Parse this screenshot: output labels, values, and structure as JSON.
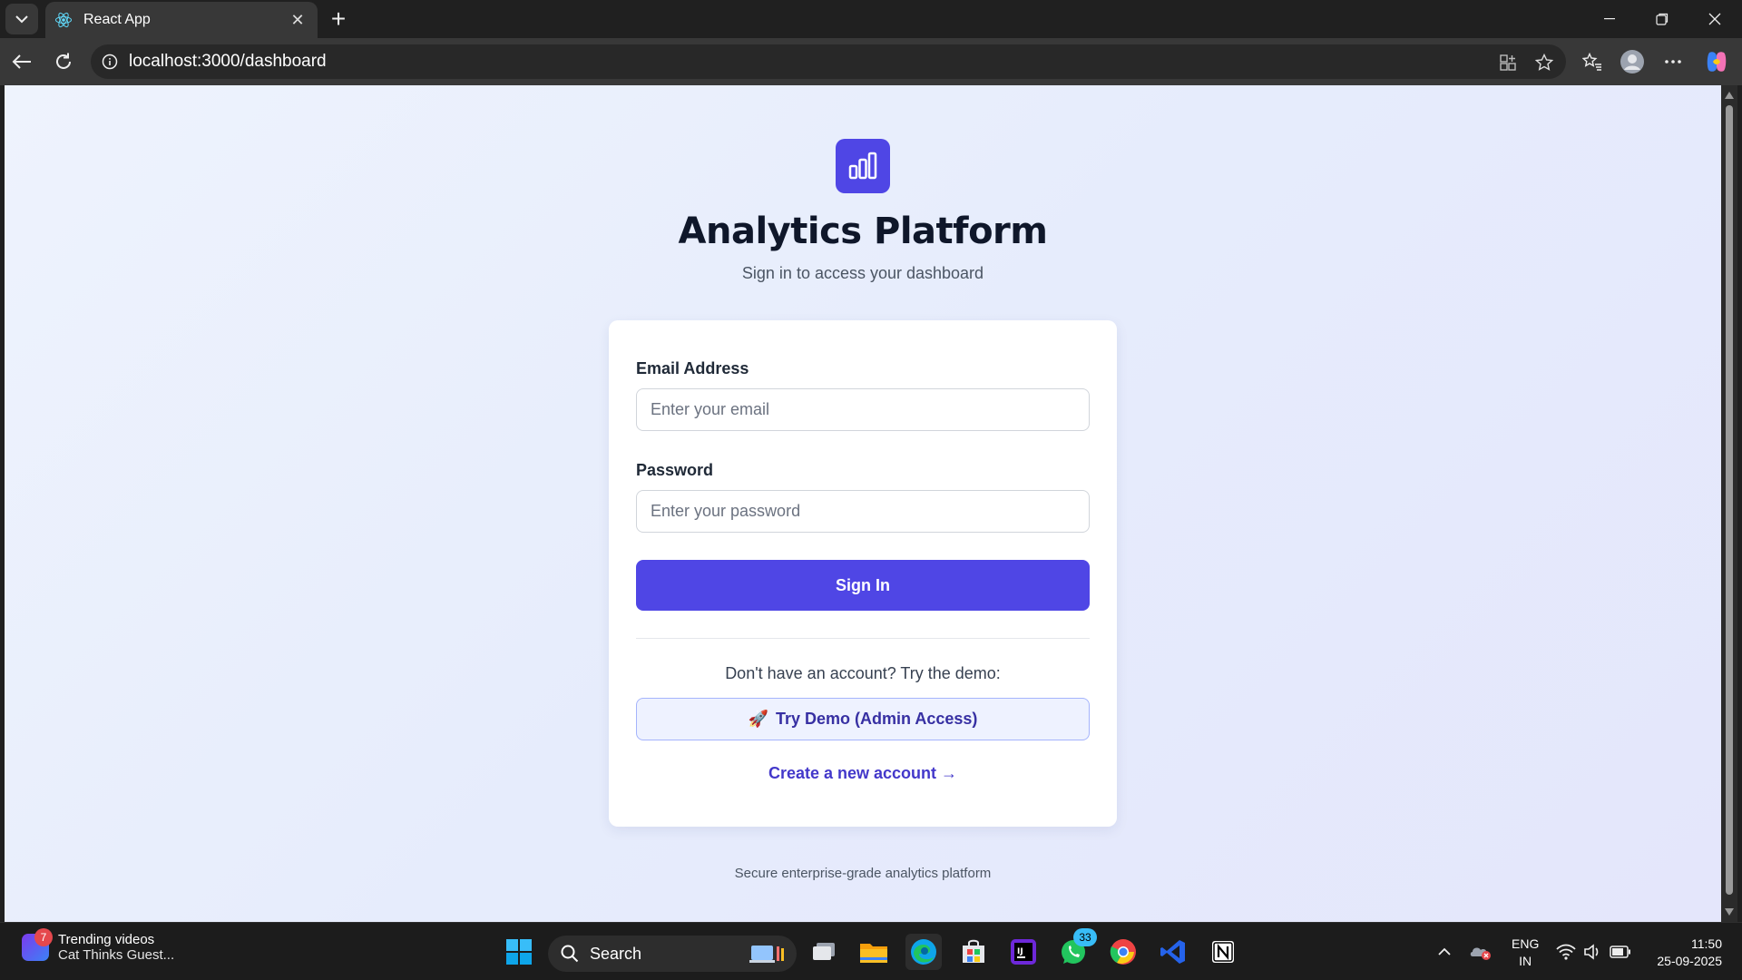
{
  "browser": {
    "tab_title": "React App",
    "url": "localhost:3000/dashboard"
  },
  "page": {
    "title": "Analytics Platform",
    "subtitle": "Sign in to access your dashboard",
    "email_label": "Email Address",
    "email_placeholder": "Enter your email",
    "email_value": "",
    "password_label": "Password",
    "password_placeholder": "Enter your password",
    "password_value": "",
    "signin_label": "Sign In",
    "demo_prompt": "Don't have an account? Try the demo:",
    "demo_button_emoji": "🚀",
    "demo_button_label": "Try Demo (Admin Access)",
    "create_account_link": "Create a new account →",
    "footer": "Secure enterprise-grade analytics platform",
    "accent_color": "#4f46e5"
  },
  "taskbar": {
    "widget_badge": "7",
    "widget_title": "Trending videos",
    "widget_subtitle": "Cat Thinks Guest...",
    "search_label": "Search",
    "whatsapp_badge": "33",
    "lang_line1": "ENG",
    "lang_line2": "IN",
    "time": "11:50",
    "date": "25-09-2025"
  }
}
